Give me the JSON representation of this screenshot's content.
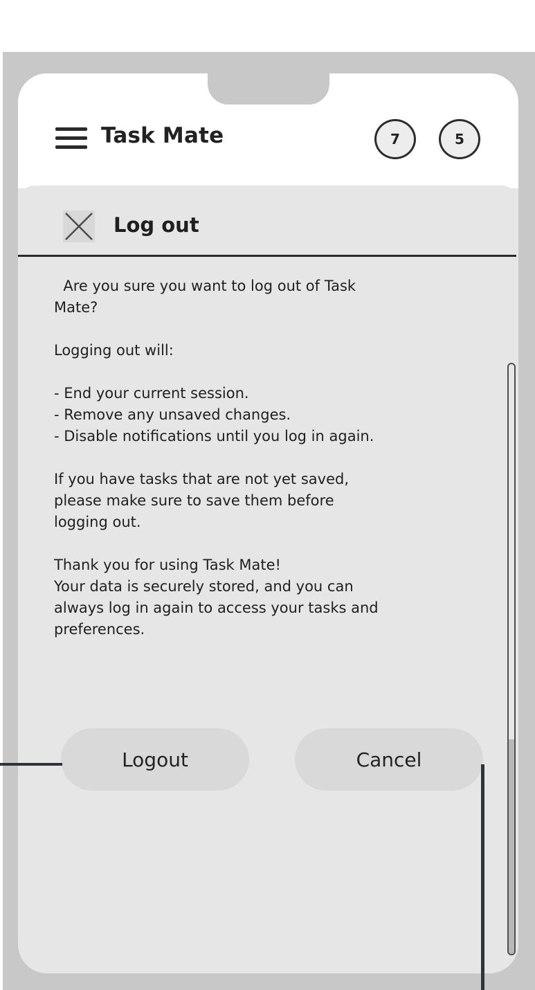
{
  "app": {
    "title": "Task Mate",
    "badges": [
      "7",
      "5"
    ]
  },
  "modal": {
    "title": "Log out",
    "body_text": "  Are you sure you want to log out of Task\nMate?\n\nLogging out will:\n\n- End your current session.\n- Remove any unsaved changes.\n- Disable notifications until you log in again.\n\nIf you have tasks that are not yet saved,\nplease make sure to save them before\nlogging out.\n\nThank you for using Task Mate!\nYour data is securely stored, and you can\nalways log in again to access your tasks and\npreferences.",
    "buttons": {
      "logout": "Logout",
      "cancel": "Cancel"
    }
  },
  "icons": {
    "menu": "menu-icon",
    "close": "close-icon"
  },
  "scroll": {
    "position_fraction": 0.63
  },
  "colors": {
    "frame": "#c8c8c8",
    "surface": "#e6e6e6",
    "button": "#d9d9d9",
    "text": "#1f1f1f",
    "connector": "#2f343b"
  }
}
